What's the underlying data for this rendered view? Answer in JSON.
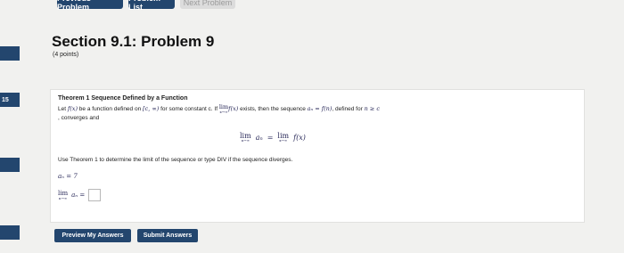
{
  "nav": {
    "previous_label": "Previous Problem",
    "list_label": "Problem List",
    "next_label": "Next Problem"
  },
  "left_tabs": [
    {
      "label": ""
    },
    {
      "label": "15"
    },
    {
      "label": ""
    },
    {
      "label": ""
    }
  ],
  "header": {
    "title": "Section 9.1: Problem 9",
    "points": "(4 points)"
  },
  "problem": {
    "theorem_title": "Theorem 1 Sequence Defined by a Function",
    "text_let": "Let ",
    "fx": "f(x)",
    "text_defined_on": " be a function defined on ",
    "interval": "[c, ∞)",
    "text_constant": " for some constant c. If ",
    "lim_word": "lim",
    "sub_x": "x→∞",
    "text_exists": " exists, then the sequence ",
    "an_def": "aₙ = f(n)",
    "text_defined_for": ", defined for ",
    "n_ge_c": "n ≥ c",
    "text_converges": ", converges and",
    "display_left": "aₙ",
    "sub_n": "n→∞",
    "equals": "=",
    "display_right": "f(x)",
    "instruction": "Use Theorem 1 to determine the limit of the sequence or type DIV if the sequence diverges.",
    "given": "aₙ = 7",
    "answer_lhs": "aₙ ="
  },
  "actions": {
    "preview_label": "Preview My Answers",
    "submit_label": "Submit Answers"
  },
  "colors": {
    "primary": "#23466e",
    "background": "#f1f1ef",
    "panel": "#ffffff"
  }
}
